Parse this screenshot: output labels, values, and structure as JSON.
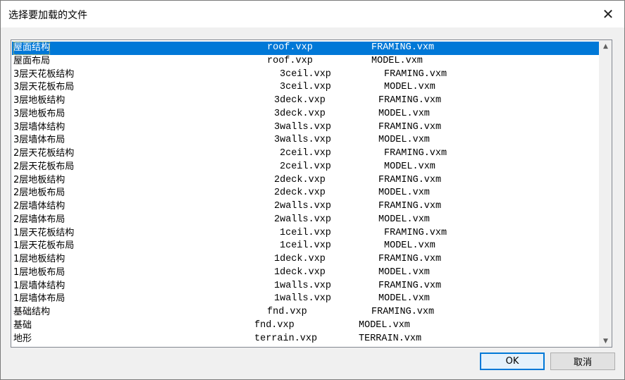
{
  "window": {
    "title": "选择要加载的文件",
    "close_glyph": "✕"
  },
  "list": {
    "selected_index": 0,
    "rows": [
      {
        "name": "屋面结构",
        "file": "roof.vxp",
        "type": "FRAMING.vxm"
      },
      {
        "name": "屋面布局",
        "file": "roof.vxp",
        "type": "MODEL.vxm"
      },
      {
        "name": "3层天花板结构",
        "file": "3ceil.vxp",
        "type": "FRAMING.vxm"
      },
      {
        "name": "3层天花板布局",
        "file": "3ceil.vxp",
        "type": "MODEL.vxm"
      },
      {
        "name": "3层地板结构",
        "file": "3deck.vxp",
        "type": "FRAMING.vxm"
      },
      {
        "name": "3层地板布局",
        "file": "3deck.vxp",
        "type": "MODEL.vxm"
      },
      {
        "name": "3层墙体结构",
        "file": "3walls.vxp",
        "type": "FRAMING.vxm"
      },
      {
        "name": "3层墙体布局",
        "file": "3walls.vxp",
        "type": "MODEL.vxm"
      },
      {
        "name": "2层天花板结构",
        "file": "2ceil.vxp",
        "type": "FRAMING.vxm"
      },
      {
        "name": "2层天花板布局",
        "file": "2ceil.vxp",
        "type": "MODEL.vxm"
      },
      {
        "name": "2层地板结构",
        "file": "2deck.vxp",
        "type": "FRAMING.vxm"
      },
      {
        "name": "2层地板布局",
        "file": "2deck.vxp",
        "type": "MODEL.vxm"
      },
      {
        "name": "2层墙体结构",
        "file": "2walls.vxp",
        "type": "FRAMING.vxm"
      },
      {
        "name": "2层墙体布局",
        "file": "2walls.vxp",
        "type": "MODEL.vxm"
      },
      {
        "name": "1层天花板结构",
        "file": "1ceil.vxp",
        "type": "FRAMING.vxm"
      },
      {
        "name": "1层天花板布局",
        "file": "1ceil.vxp",
        "type": "MODEL.vxm"
      },
      {
        "name": "1层地板结构",
        "file": "1deck.vxp",
        "type": "FRAMING.vxm"
      },
      {
        "name": "1层地板布局",
        "file": "1deck.vxp",
        "type": "MODEL.vxm"
      },
      {
        "name": "1层墙体结构",
        "file": "1walls.vxp",
        "type": "FRAMING.vxm"
      },
      {
        "name": "1层墙体布局",
        "file": "1walls.vxp",
        "type": "MODEL.vxm"
      },
      {
        "name": "基础结构",
        "file": "fnd.vxp",
        "type": "FRAMING.vxm"
      },
      {
        "name": "基础",
        "file": "fnd.vxp",
        "type": "MODEL.vxm"
      },
      {
        "name": "地形",
        "file": "terrain.vxp",
        "type": "TERRAIN.vxm"
      }
    ]
  },
  "scrollbar": {
    "up_icon": "chevron-up-icon",
    "down_icon": "chevron-down-icon"
  },
  "buttons": {
    "ok": "OK",
    "cancel": "取消"
  },
  "colors": {
    "selection": "#0078d7",
    "default_button_border": "#0078d7"
  }
}
